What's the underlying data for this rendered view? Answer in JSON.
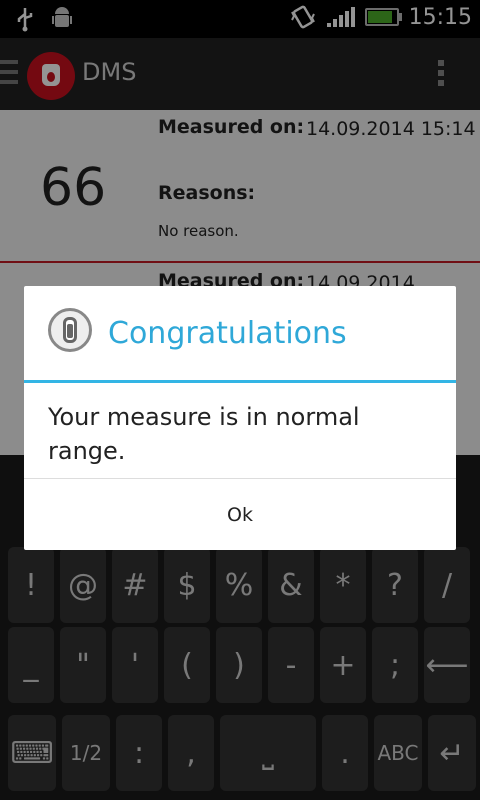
{
  "status_bar": {
    "time": "15:15",
    "icons": [
      "usb-icon",
      "android-debug-icon",
      "vibrate-icon",
      "signal-icon",
      "battery-icon"
    ],
    "battery_level": 0.95,
    "battery_color": "#4caf2a"
  },
  "action_bar": {
    "title": "DMS",
    "logo_color": "#c8101e"
  },
  "records": [
    {
      "value": "66",
      "measured_label": "Measured on:",
      "measured_value": "14.09.2014 15:14",
      "reasons_label": "Reasons:",
      "reasons_value": "No reason."
    },
    {
      "measured_label": "Measured on:",
      "measured_value": "14.09.2014"
    }
  ],
  "dialog": {
    "title": "Congratulations",
    "message": "Your measure is in normal range.",
    "ok_label": "Ok",
    "accent": "#33b5e5"
  },
  "keyboard": {
    "row1": [
      "!",
      "@",
      "#",
      "$",
      "%",
      "&",
      "*",
      "?",
      "/"
    ],
    "row2": [
      "_",
      "\"",
      "'",
      "(",
      ")",
      "-",
      "+",
      ";",
      "⟵"
    ],
    "row3": [
      "⌨",
      "1/2",
      ":",
      ",",
      "⎵",
      ".",
      "ABC",
      "↵"
    ]
  }
}
